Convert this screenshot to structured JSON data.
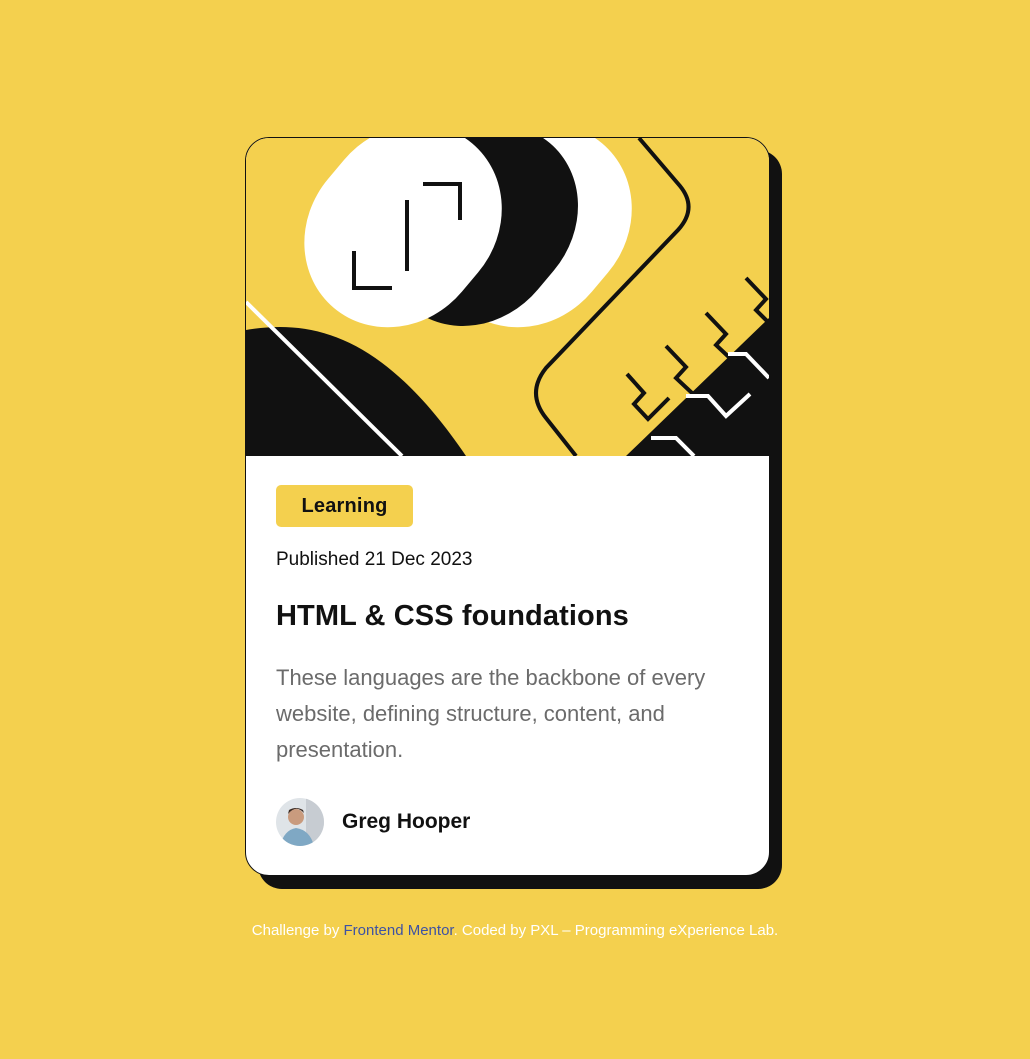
{
  "card": {
    "tag": "Learning",
    "published": "Published 21 Dec 2023",
    "title": "HTML & CSS foundations",
    "description": "These languages are the backbone of every website, defining structure, content, and presentation.",
    "author": "Greg Hooper"
  },
  "attribution": {
    "prefix": "Challenge by ",
    "link1": "Frontend Mentor",
    "middle": ". Coded by ",
    "link2": "PXL – Programming eXperience Lab",
    "suffix": "."
  },
  "colors": {
    "background": "#f4d04e",
    "card": "#ffffff",
    "ink": "#111111",
    "muted": "#6b6b6b",
    "link": "#3e52a3"
  },
  "icons": {
    "hero": "abstract-illustration",
    "avatar": "author-photo"
  }
}
